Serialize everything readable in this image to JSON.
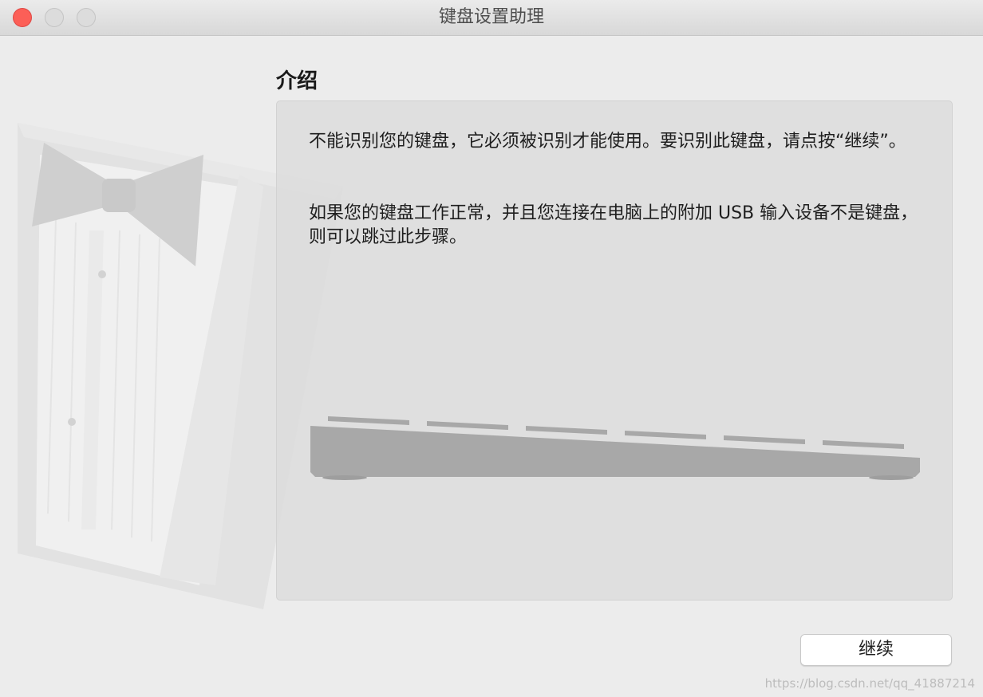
{
  "window": {
    "title": "键盘设置助理"
  },
  "titlebar_buttons": [
    "close-icon",
    "minimize-icon",
    "zoom-icon"
  ],
  "illustration_icon": "tuxedo-shirt-bowtie-illustration",
  "section": {
    "heading": "介绍"
  },
  "panel": {
    "paragraph_1": "不能识别您的键盘，它必须被识别才能使用。要识别此键盘，请点按“继续”。",
    "paragraph_2": "如果您的键盘工作正常，并且您连接在电脑上的附加 USB 输入设备不是键盘，则可以跳过此步骤。",
    "keyboard_icon": "keyboard-side-view-icon"
  },
  "buttons": {
    "continue_label": "继续"
  },
  "watermark": "https://blog.csdn.net/qq_41887214",
  "colors": {
    "close": "#fc5f57",
    "inactive_traffic": "#dcdcdc",
    "window_bg": "#ececec",
    "panel_bg": "#dcdcdc",
    "keyboard": "#a8a8a8"
  }
}
